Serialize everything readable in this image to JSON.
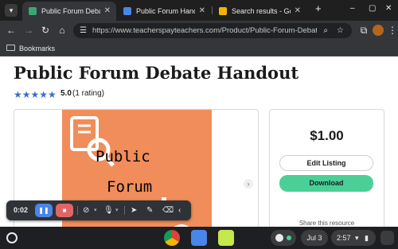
{
  "tabs": [
    {
      "title": "Public Forum Debate Ha",
      "active": true,
      "favicon_color": "#3aa676"
    },
    {
      "title": "Public Forum Handout -",
      "active": false,
      "favicon_color": "#4a86e8"
    },
    {
      "title": "Search results - Google",
      "active": false,
      "favicon_color": "#f4b400"
    }
  ],
  "toolbar": {
    "url": "https://www.teacherspayteachers.com/Product/Public-Forum-Debate-Ha..."
  },
  "bookmarks": {
    "label": "Bookmarks"
  },
  "product": {
    "title": "Public Forum Debate Handout",
    "stars": "★★★★★",
    "score": "5.0",
    "rating_count": "(1 rating)",
    "cover_line1": "Public",
    "cover_line2": "Forum",
    "price": "$1.00",
    "edit_label": "Edit Listing",
    "download_label": "Download",
    "share_text": "Share this resource"
  },
  "recorder": {
    "time": "0:02"
  },
  "shelf": {
    "date": "Jul 3",
    "time": "2:57"
  },
  "colors": {
    "accent_green": "#4ad096",
    "cover_orange": "#f08d5a",
    "star_blue": "#3f6ec6"
  }
}
